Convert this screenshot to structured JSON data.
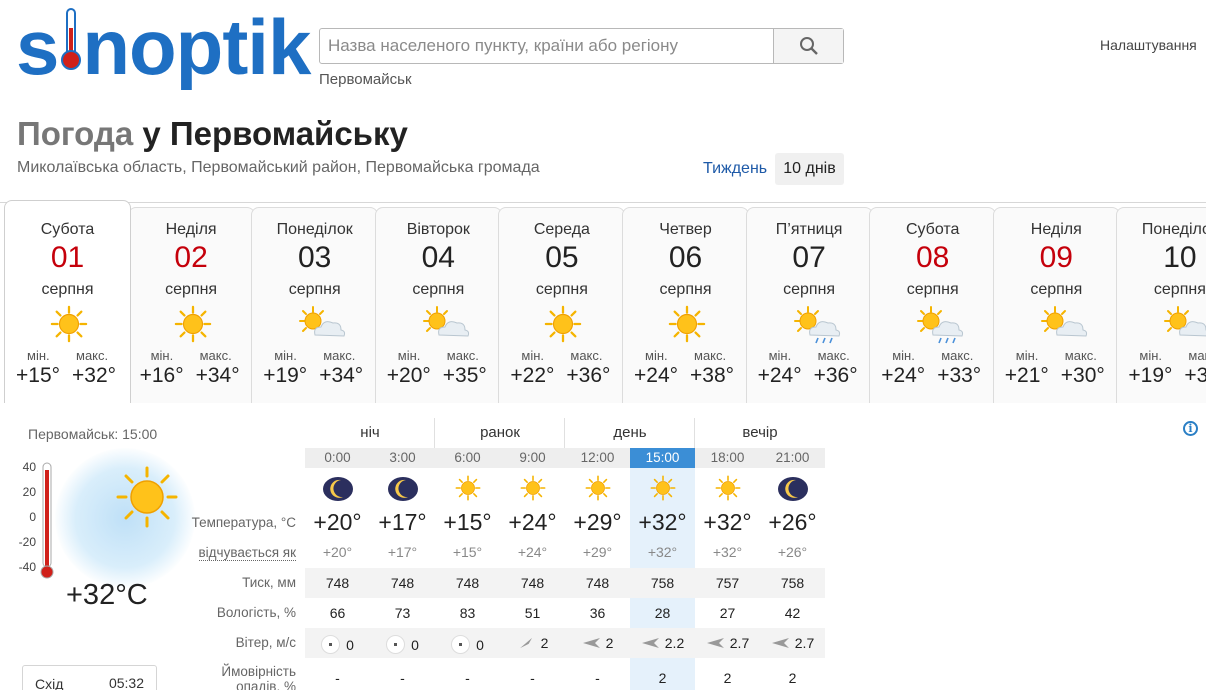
{
  "brand": {
    "logo_text_a": "s",
    "logo_text_b": "noptik"
  },
  "search": {
    "placeholder": "Назва населеного пункту, країни або регіону",
    "recent": "Первомайськ"
  },
  "settings_label": "Налаштування",
  "title": {
    "prefix": "Погода",
    "rest": " у Первомайську"
  },
  "region": "Миколаївська область, Первомайський район, Первомайська громада",
  "view_links": {
    "week": "Тиждень",
    "ten_days": "10 днів"
  },
  "labels": {
    "min": "мін.",
    "max": "макс."
  },
  "days": [
    {
      "name": "Субота",
      "num": "01",
      "month": "серпня",
      "min": "+15°",
      "max": "+32°",
      "weekend": true,
      "icon": "sun-icon"
    },
    {
      "name": "Неділя",
      "num": "02",
      "month": "серпня",
      "min": "+16°",
      "max": "+34°",
      "weekend": true,
      "icon": "sun-icon"
    },
    {
      "name": "Понеділок",
      "num": "03",
      "month": "серпня",
      "min": "+19°",
      "max": "+34°",
      "weekend": false,
      "icon": "sun-cloud-icon"
    },
    {
      "name": "Вівторок",
      "num": "04",
      "month": "серпня",
      "min": "+20°",
      "max": "+35°",
      "weekend": false,
      "icon": "sun-cloud-icon"
    },
    {
      "name": "Середа",
      "num": "05",
      "month": "серпня",
      "min": "+22°",
      "max": "+36°",
      "weekend": false,
      "icon": "sun-icon"
    },
    {
      "name": "Четвер",
      "num": "06",
      "month": "серпня",
      "min": "+24°",
      "max": "+38°",
      "weekend": false,
      "icon": "sun-icon"
    },
    {
      "name": "П’ятниця",
      "num": "07",
      "month": "серпня",
      "min": "+24°",
      "max": "+36°",
      "weekend": false,
      "icon": "sun-cloud-rain-icon"
    },
    {
      "name": "Субота",
      "num": "08",
      "month": "серпня",
      "min": "+24°",
      "max": "+33°",
      "weekend": true,
      "icon": "sun-cloud-rain-icon"
    },
    {
      "name": "Неділя",
      "num": "09",
      "month": "серпня",
      "min": "+21°",
      "max": "+30°",
      "weekend": true,
      "icon": "sun-cloud-icon"
    },
    {
      "name": "Понеділок",
      "num": "10",
      "month": "серпня",
      "min": "+19°",
      "max": "+3",
      "weekend": false,
      "icon": "sun-cloud-icon"
    }
  ],
  "current": {
    "place_time": "Первомайськ: 15:00",
    "temp": "+32°C",
    "scale": [
      "40",
      "20",
      "0",
      "-20",
      "-40"
    ]
  },
  "sunrise": {
    "label": "Схід",
    "time": "05:32"
  },
  "periods": [
    "ніч",
    "ранок",
    "день",
    "вечір"
  ],
  "row_labels": {
    "temp": "Температура, °C",
    "feels": "відчувається як",
    "pressure": "Тиск, мм",
    "humidity": "Вологість, %",
    "wind": "Вітер, м/с",
    "precip_1": "Ймовірність",
    "precip_2": "опадів, %"
  },
  "hours": [
    {
      "time": "0:00",
      "icon": "moon-icon",
      "temp": "+20°",
      "feels": "+20°",
      "pressure": "748",
      "humidity": "66",
      "wind": "0",
      "wind_dir": "calm",
      "precip": "-"
    },
    {
      "time": "3:00",
      "icon": "moon-icon",
      "temp": "+17°",
      "feels": "+17°",
      "pressure": "748",
      "humidity": "73",
      "wind": "0",
      "wind_dir": "calm",
      "precip": "-"
    },
    {
      "time": "6:00",
      "icon": "sun-icon",
      "temp": "+15°",
      "feels": "+15°",
      "pressure": "748",
      "humidity": "83",
      "wind": "0",
      "wind_dir": "calm",
      "precip": "-"
    },
    {
      "time": "9:00",
      "icon": "sun-icon",
      "temp": "+24°",
      "feels": "+24°",
      "pressure": "748",
      "humidity": "51",
      "wind": "2",
      "wind_dir": "southwest",
      "precip": "-"
    },
    {
      "time": "12:00",
      "icon": "sun-icon",
      "temp": "+29°",
      "feels": "+29°",
      "pressure": "748",
      "humidity": "36",
      "wind": "2",
      "wind_dir": "east",
      "precip": "-"
    },
    {
      "time": "15:00",
      "icon": "sun-icon",
      "temp": "+32°",
      "feels": "+32°",
      "pressure": "758",
      "humidity": "28",
      "wind": "2.2",
      "wind_dir": "east",
      "precip": "2"
    },
    {
      "time": "18:00",
      "icon": "sun-icon",
      "temp": "+32°",
      "feels": "+32°",
      "pressure": "757",
      "humidity": "27",
      "wind": "2.7",
      "wind_dir": "east",
      "precip": "2"
    },
    {
      "time": "21:00",
      "icon": "moon-icon",
      "temp": "+26°",
      "feels": "+26°",
      "pressure": "758",
      "humidity": "42",
      "wind": "2.7",
      "wind_dir": "east",
      "precip": "2"
    }
  ],
  "colors": {
    "brand_blue": "#1e6fc3",
    "weekend_red": "#c5000b",
    "highlight": "#3b8ed6",
    "highlight_col": "#e5f1fb"
  }
}
